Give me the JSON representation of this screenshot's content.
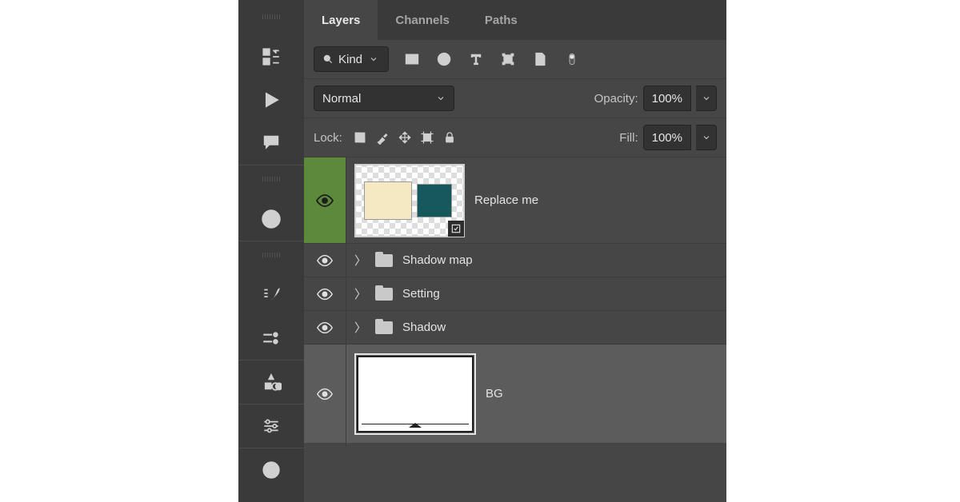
{
  "tabs": {
    "layers": "Layers",
    "channels": "Channels",
    "paths": "Paths"
  },
  "filter": {
    "kind": "Kind"
  },
  "blend": {
    "mode": "Normal",
    "opacity_label": "Opacity:",
    "opacity_value": "100%"
  },
  "lock": {
    "label": "Lock:",
    "fill_label": "Fill:",
    "fill_value": "100%"
  },
  "layers": {
    "items": [
      {
        "name": "Replace me",
        "type": "smart-object",
        "visible": true,
        "active": true
      },
      {
        "name": "Shadow map",
        "type": "group",
        "visible": true
      },
      {
        "name": "Setting",
        "type": "group",
        "visible": true
      },
      {
        "name": "Shadow",
        "type": "group",
        "visible": true
      },
      {
        "name": "BG",
        "type": "pixel",
        "visible": true
      }
    ]
  }
}
